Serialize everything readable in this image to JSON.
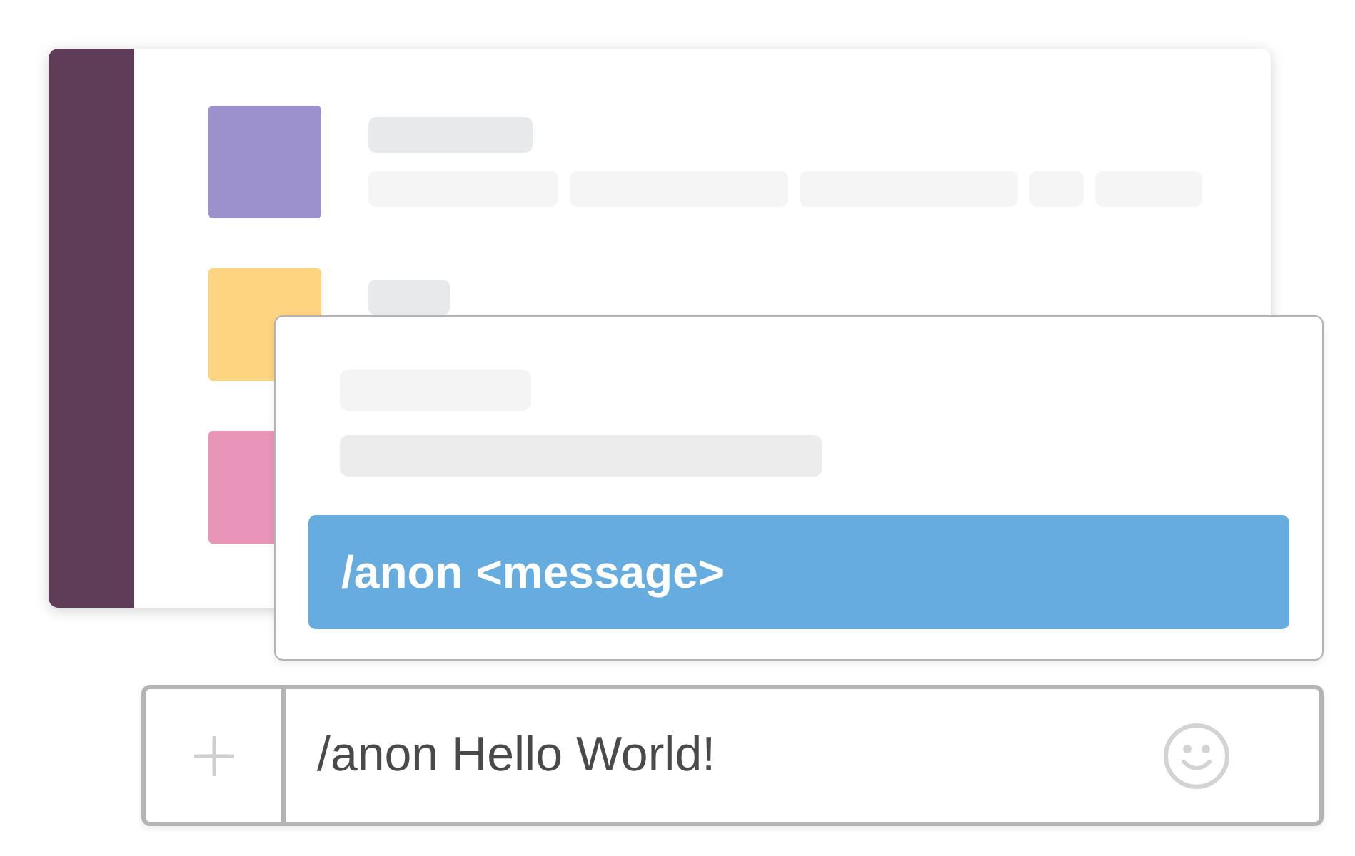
{
  "message_list": {
    "messages": [
      {
        "color": "#9c90cd"
      },
      {
        "color": "#fdd47f"
      },
      {
        "color": "#e994b9"
      }
    ]
  },
  "autocomplete": {
    "suggestions": [
      {
        "label": "/anon <message>",
        "selected": true
      }
    ]
  },
  "composer": {
    "value": "/anon Hello World!"
  }
}
